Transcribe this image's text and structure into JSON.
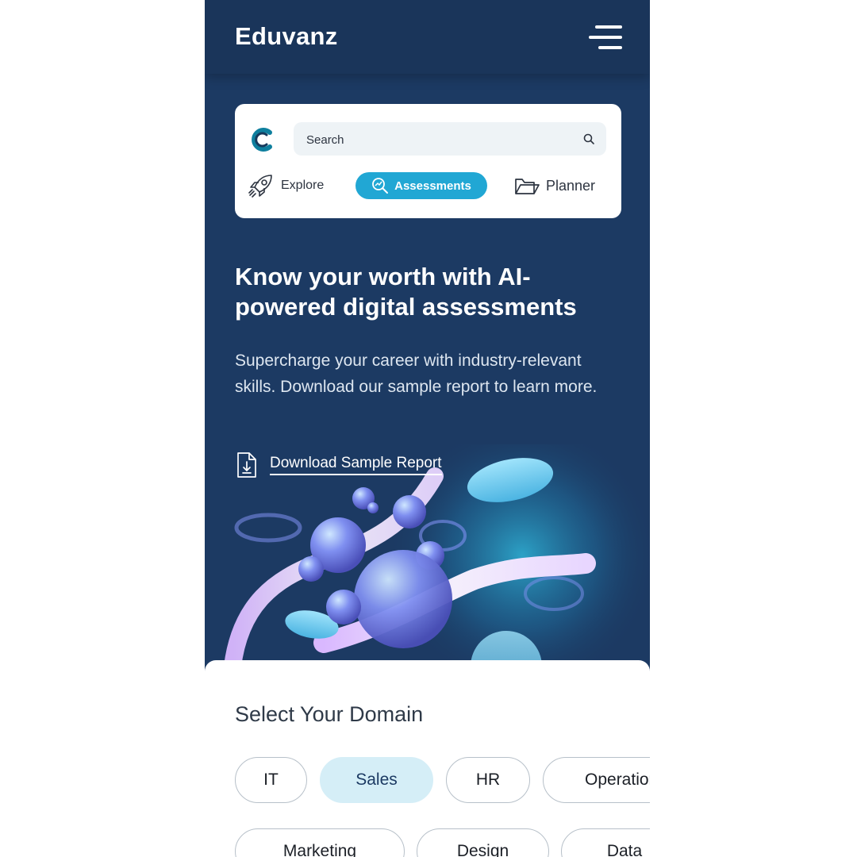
{
  "header": {
    "brand": "Eduvanz"
  },
  "search": {
    "placeholder": "Search"
  },
  "nav": {
    "explore": "Explore",
    "assessments": "Assessments",
    "planner": "Planner",
    "active": "Assessments"
  },
  "hero": {
    "headline": "Know your worth with AI-powered digital assessments",
    "subtext": "Supercharge your career with industry-relevant skills. Download our sample report to learn more.",
    "download_label": "Download Sample Report"
  },
  "domain": {
    "title": "Select Your Domain",
    "chips": [
      "IT",
      "Sales",
      "HR",
      "Operations",
      "Marketing",
      "Design",
      "Data"
    ],
    "selected": "Sales"
  },
  "colors": {
    "header_bg": "#1a355a",
    "page_bg": "#1c3a63",
    "accent": "#21a7d4",
    "chip_selected_bg": "#d5eef7"
  },
  "icons": [
    "menu-icon",
    "brand-logo-icon",
    "search-icon",
    "rocket-icon",
    "analytics-icon",
    "folder-icon",
    "download-file-icon"
  ]
}
